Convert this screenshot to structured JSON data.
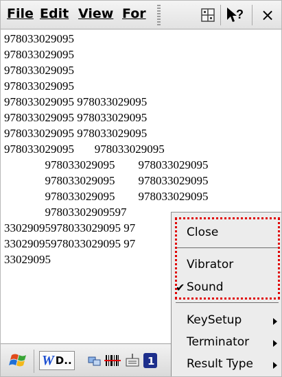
{
  "menubar": {
    "file": "File",
    "edit": "Edit",
    "view": "View",
    "format": "For",
    "help_symbol": "?",
    "close_symbol": "×"
  },
  "textarea": {
    "lines": [
      "978033029095",
      "978033029095",
      "978033029095",
      "978033029095",
      "978033029095 978033029095",
      "978033029095 978033029095",
      "978033029095 978033029095",
      "978033029095       978033029095",
      "              978033029095        978033029095",
      "              978033029095        978033029095",
      "              978033029095        978033029095",
      "              97803302909597",
      "33029095978033029095 97",
      "33029095978033029095 97",
      "33029095"
    ]
  },
  "popup_menu": {
    "close": "Close",
    "vibrator": "Vibrator",
    "sound": "Sound",
    "sound_checked": true,
    "keysetup": "KeySetup",
    "terminator": "Terminator",
    "result_type": "Result Type"
  },
  "taskbar": {
    "word_label": "D.."
  },
  "colors": {
    "highlight": "#e00000"
  }
}
